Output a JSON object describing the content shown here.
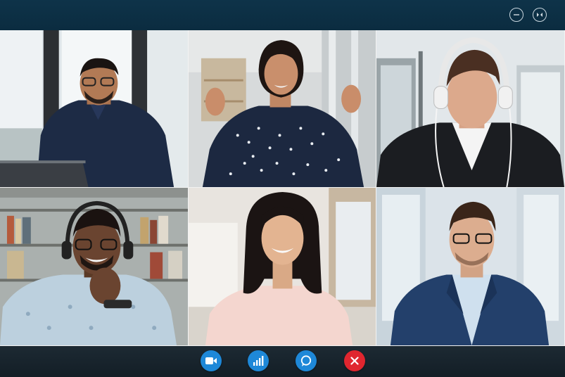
{
  "window": {
    "controls": [
      {
        "icon": "minimize-icon"
      },
      {
        "icon": "collapse-arrows-icon"
      }
    ]
  },
  "participants": [
    {
      "position": "top-left",
      "description_icon": "participant-video"
    },
    {
      "position": "top-center",
      "description_icon": "participant-video"
    },
    {
      "position": "top-right",
      "description_icon": "participant-video"
    },
    {
      "position": "bottom-left",
      "description_icon": "participant-video"
    },
    {
      "position": "bottom-center",
      "description_icon": "participant-video"
    },
    {
      "position": "bottom-right",
      "description_icon": "participant-video"
    }
  ],
  "controls": [
    {
      "icon": "video-camera-icon",
      "color": "#1e88d8"
    },
    {
      "icon": "signal-bars-icon",
      "color": "#1e88d8"
    },
    {
      "icon": "chat-bubble-icon",
      "color": "#1e88d8"
    },
    {
      "icon": "close-icon",
      "color": "#e0262f"
    }
  ],
  "colors": {
    "titlebar": "#0d2e42",
    "bottombar": "#17232c",
    "accent": "#1e88d8",
    "end_call": "#e0262f"
  }
}
